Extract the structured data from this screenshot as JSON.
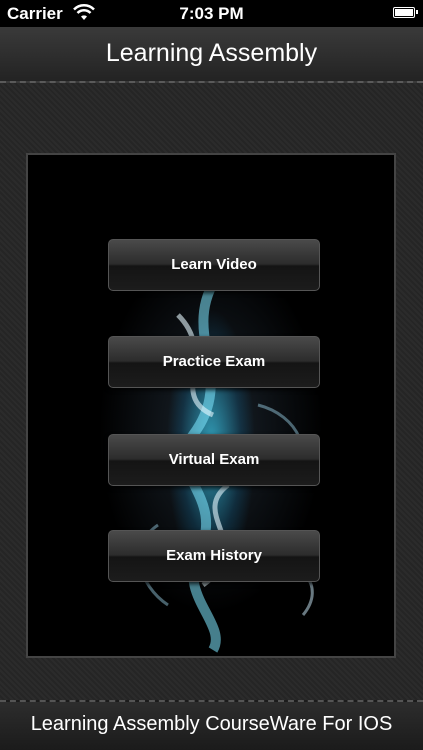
{
  "status_bar": {
    "carrier": "Carrier",
    "time": "7:03 PM"
  },
  "nav": {
    "title": "Learning Assembly"
  },
  "menu": {
    "items": [
      {
        "label": "Learn Video"
      },
      {
        "label": "Practice Exam"
      },
      {
        "label": "Virtual Exam"
      },
      {
        "label": "Exam History"
      }
    ]
  },
  "footer": {
    "text": "Learning Assembly CourseWare For IOS"
  },
  "colors": {
    "accent_glow": "#3cdcff",
    "background": "#272727"
  }
}
